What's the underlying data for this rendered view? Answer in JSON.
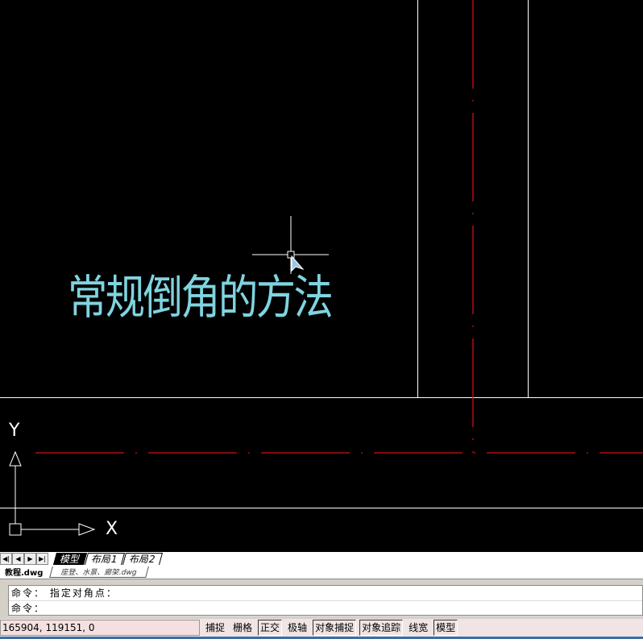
{
  "drawing": {
    "text": "常规倒角的方法",
    "text_color": "#7fd4e0",
    "axis_x": "X",
    "axis_y": "Y"
  },
  "layout_tabs": {
    "nav": [
      "◀|",
      "◀",
      "▶",
      "▶|"
    ],
    "tabs": [
      {
        "label": "模型",
        "active": true
      },
      {
        "label": "布局1"
      },
      {
        "label": "布局2"
      }
    ]
  },
  "file_tabs": [
    {
      "label": "教程.dwg",
      "active": true
    },
    {
      "label": "座登、水景、廊架.dwg"
    }
  ],
  "command": {
    "lines": [
      "命令： 指定对角点：",
      "命令："
    ]
  },
  "status": {
    "coords": "165904, 119151, 0",
    "buttons": [
      {
        "label": "捕捉",
        "on": false
      },
      {
        "label": "栅格",
        "on": false
      },
      {
        "label": "正交",
        "on": true
      },
      {
        "label": "极轴",
        "on": false
      },
      {
        "label": "对象捕捉",
        "on": true
      },
      {
        "label": "对象追踪",
        "on": true
      },
      {
        "label": "线宽",
        "on": false
      },
      {
        "label": "模型",
        "on": true
      }
    ]
  }
}
